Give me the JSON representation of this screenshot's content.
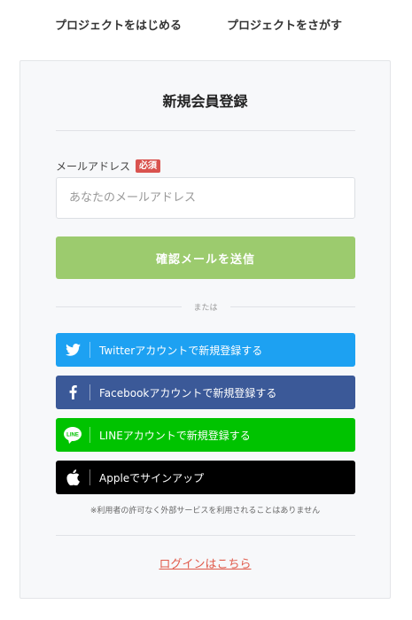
{
  "nav": {
    "start_project": "プロジェクトをはじめる",
    "find_project": "プロジェクトをさがす"
  },
  "form": {
    "title": "新規会員登録",
    "email_label": "メールアドレス",
    "required_badge": "必須",
    "email_placeholder": "あなたのメールアドレス",
    "email_value": "",
    "send_button": "確認メールを送信",
    "or_text": "または"
  },
  "social": {
    "twitter": "Twitterアカウントで新規登録する",
    "facebook": "Facebookアカウントで新規登録する",
    "line": "LINEアカウントで新規登録する",
    "apple": "Appleでサインアップ"
  },
  "disclaimer": "※利用者の許可なく外部サービスを利用されることはありません",
  "login_link": "ログインはこちら",
  "colors": {
    "send_button": "#9ccb6e",
    "twitter": "#1da1f2",
    "facebook": "#3b5998",
    "line": "#00c300",
    "apple": "#000000",
    "required_badge": "#d9534f",
    "login_link": "#e05a4a"
  },
  "icons": {
    "twitter": "twitter-bird-icon",
    "facebook": "facebook-f-icon",
    "line": "line-logo-icon",
    "apple": "apple-logo-icon"
  }
}
